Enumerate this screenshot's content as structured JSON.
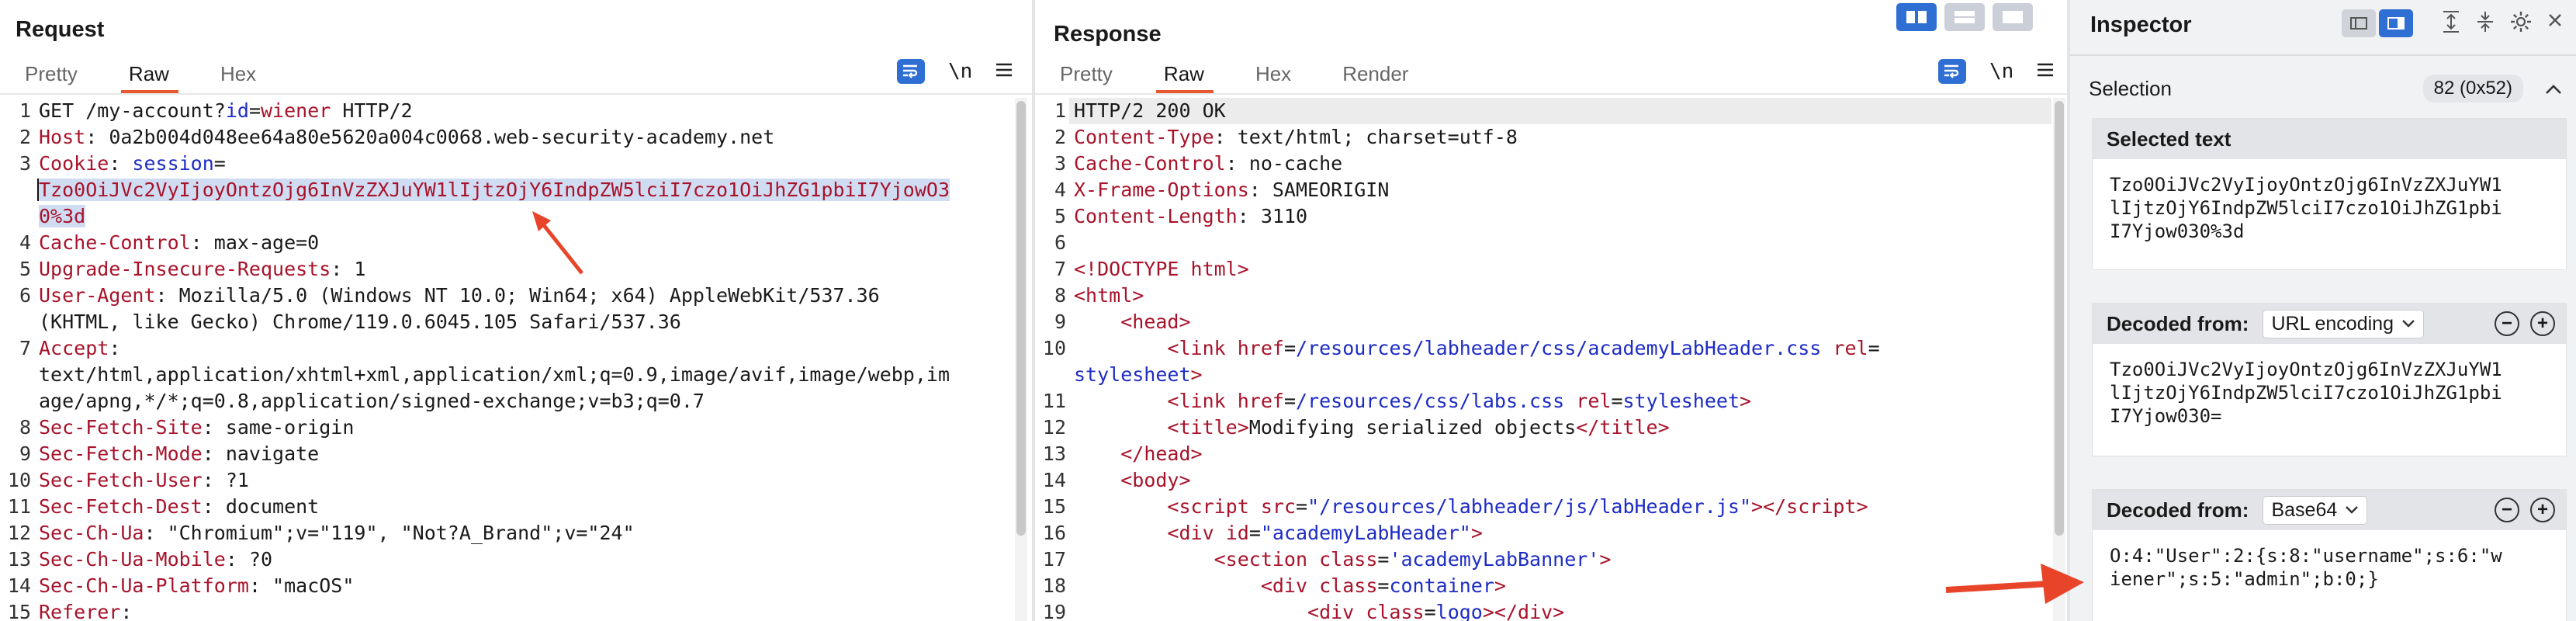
{
  "request": {
    "title": "Request",
    "tabs": [
      "Pretty",
      "Raw",
      "Hex"
    ],
    "active_tab": "Raw",
    "newline_label": "\\n",
    "lines": [
      {
        "n": "1",
        "html": "GET /my-account?<span class='b'>id</span>=<span class='k'>wiener</span> HTTP/2"
      },
      {
        "n": "2",
        "html": "<span class='k'>Host</span>: 0a2b004d048ee64a80e5620a004c0068.web-security-academy.net"
      },
      {
        "n": "3",
        "html": "<span class='k'>Cookie</span>: <span class='b'>session</span>="
      },
      {
        "n": "",
        "html": "<span class='sel sel-first'><span class='k'>Tzo0OiJVc2VyIjoyOntzOjg6InVzZXJuYW1lIjtzOjY6IndpZW5lciI7czo1OiJhZG1pbiI7Yjow</span></span><span class='sel k'>O3</span>"
      },
      {
        "n": "",
        "html": "<span class='sel k'>0%3d</span>"
      },
      {
        "n": "4",
        "html": "<span class='k'>Cache-Control</span>: max-age=0"
      },
      {
        "n": "5",
        "html": "<span class='k'>Upgrade-Insecure-Requests</span>: 1"
      },
      {
        "n": "6",
        "html": "<span class='k'>User-Agent</span>: Mozilla/5.0 (Windows NT 10.0; Win64; x64) AppleWebKit/537.36"
      },
      {
        "n": "",
        "html": "(KHTML, like Gecko) Chrome/119.0.6045.105 Safari/537.36"
      },
      {
        "n": "7",
        "html": "<span class='k'>Accept</span>:"
      },
      {
        "n": "",
        "html": "text/html,application/xhtml+xml,application/xml;q=0.9,image/avif,image/webp,im"
      },
      {
        "n": "",
        "html": "age/apng,*/*;q=0.8,application/signed-exchange;v=b3;q=0.7"
      },
      {
        "n": "8",
        "html": "<span class='k'>Sec-Fetch-Site</span>: same-origin"
      },
      {
        "n": "9",
        "html": "<span class='k'>Sec-Fetch-Mode</span>: navigate"
      },
      {
        "n": "10",
        "html": "<span class='k'>Sec-Fetch-User</span>: ?1"
      },
      {
        "n": "11",
        "html": "<span class='k'>Sec-Fetch-Dest</span>: document"
      },
      {
        "n": "12",
        "html": "<span class='k'>Sec-Ch-Ua</span>: \"Chromium\";v=\"119\", \"Not?A_Brand\";v=\"24\""
      },
      {
        "n": "13",
        "html": "<span class='k'>Sec-Ch-Ua-Mobile</span>: ?0"
      },
      {
        "n": "14",
        "html": "<span class='k'>Sec-Ch-Ua-Platform</span>: \"macOS\""
      },
      {
        "n": "15",
        "html": "<span class='k'>Referer</span>:"
      }
    ]
  },
  "response": {
    "title": "Response",
    "tabs": [
      "Pretty",
      "Raw",
      "Hex",
      "Render"
    ],
    "active_tab": "Raw",
    "newline_label": "\\n",
    "lines": [
      {
        "n": "1",
        "html": "HTTP/2 200 OK"
      },
      {
        "n": "2",
        "html": "<span class='k'>Content-Type</span>: text/html; charset=utf-8"
      },
      {
        "n": "3",
        "html": "<span class='k'>Cache-Control</span>: no-cache"
      },
      {
        "n": "4",
        "html": "<span class='k'>X-Frame-Options</span>: SAMEORIGIN"
      },
      {
        "n": "5",
        "html": "<span class='k'>Content-Length</span>: 3110"
      },
      {
        "n": "6",
        "html": ""
      },
      {
        "n": "7",
        "html": "<span class='t'>&lt;!DOCTYPE html&gt;</span>"
      },
      {
        "n": "8",
        "html": "<span class='t'>&lt;html&gt;</span>"
      },
      {
        "n": "9",
        "html": "    <span class='t'>&lt;head&gt;</span>"
      },
      {
        "n": "10",
        "html": "        <span class='t'>&lt;link</span> <span class='k'>href</span>=<span class='b'>/resources/labheader/css/academyLabHeader.css</span> <span class='k'>rel</span>="
      },
      {
        "n": "",
        "html": "<span class='b'>stylesheet</span><span class='t'>&gt;</span>"
      },
      {
        "n": "11",
        "html": "        <span class='t'>&lt;link</span> <span class='k'>href</span>=<span class='b'>/resources/css/labs.css</span> <span class='k'>rel</span>=<span class='b'>stylesheet</span><span class='t'>&gt;</span>"
      },
      {
        "n": "12",
        "html": "        <span class='t'>&lt;title&gt;</span>Modifying serialized objects<span class='t'>&lt;/title&gt;</span>"
      },
      {
        "n": "13",
        "html": "    <span class='t'>&lt;/head&gt;</span>"
      },
      {
        "n": "14",
        "html": "    <span class='t'>&lt;body&gt;</span>"
      },
      {
        "n": "15",
        "html": "        <span class='t'>&lt;script</span> <span class='k'>src</span>=<span class='b'>\"/resources/labheader/js/labHeader.js\"</span><span class='t'>&gt;&lt;/script&gt;</span>"
      },
      {
        "n": "16",
        "html": "        <span class='t'>&lt;div</span> <span class='k'>id</span>=<span class='b'>\"academyLabHeader\"</span><span class='t'>&gt;</span>"
      },
      {
        "n": "17",
        "html": "            <span class='t'>&lt;section</span> <span class='k'>class</span>=<span class='b'>'academyLabBanner'</span><span class='t'>&gt;</span>"
      },
      {
        "n": "18",
        "html": "                <span class='t'>&lt;div</span> <span class='k'>class</span>=<span class='b'>container</span><span class='t'>&gt;</span>"
      },
      {
        "n": "19",
        "html": "                    <span class='t'>&lt;div</span> <span class='k'>class</span>=<span class='b'>logo</span><span class='t'>&gt;&lt;/div&gt;</span>"
      }
    ]
  },
  "inspector": {
    "title": "Inspector",
    "selection_label": "Selection",
    "selection_badge": "82 (0x52)",
    "selected_text_label": "Selected text",
    "selected_text": "Tzo0OiJVc2VyIjoyOntzOjg6InVzZXJuYW1\nlIjtzOjY6IndpZW5lciI7czo1OiJhZG1pbi\nI7Yjow030%3d",
    "decoded1_label": "Decoded from:",
    "decoded1_encoding": "URL encoding",
    "decoded1_text": "Tzo0OiJVc2VyIjoyOntzOjg6InVzZXJuYW1\nlIjtzOjY6IndpZW5lciI7czo1OiJhZG1pbi\nI7Yjow030=",
    "decoded2_label": "Decoded from:",
    "decoded2_encoding": "Base64",
    "decoded2_text": "O:4:\"User\":2:{s:8:\"username\";s:6:\"w\niener\";s:5:\"admin\";b:0;}"
  },
  "colors": {
    "accent": "#2f6fd4",
    "tab_underline": "#e8572d",
    "key_red": "#a8132b",
    "value_blue": "#1d2cc4",
    "selection": "#cfdcf2",
    "annotation_arrow": "#e8442a"
  }
}
